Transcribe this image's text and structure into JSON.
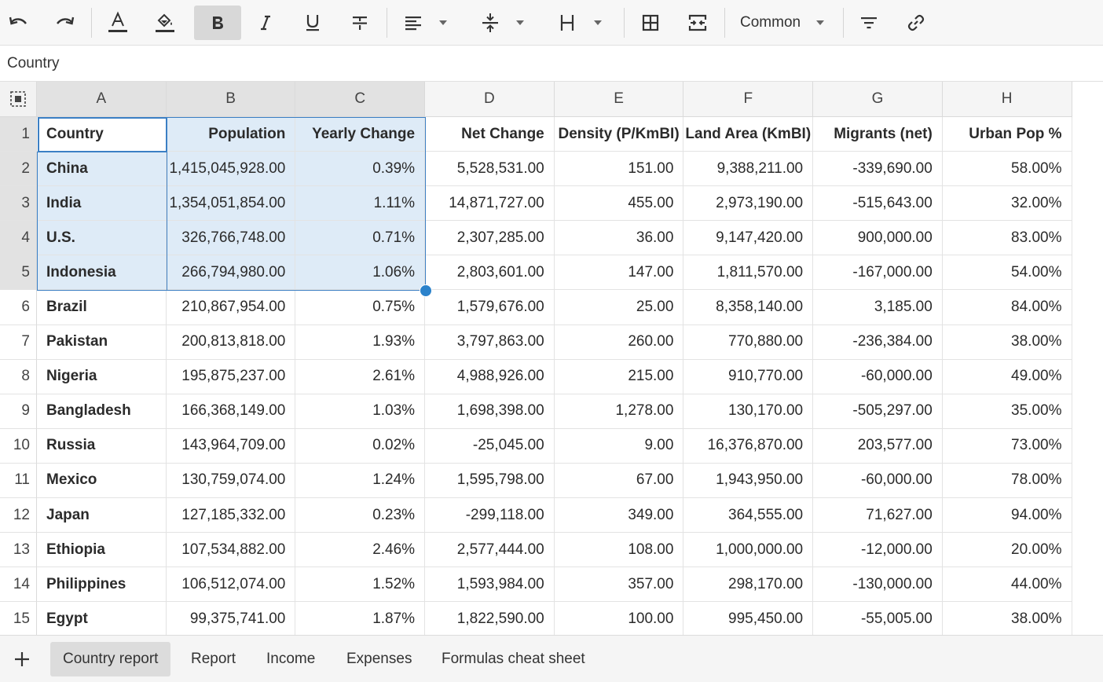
{
  "toolbar": {
    "font_style_label": "Common"
  },
  "formula_bar": {
    "value": "Country"
  },
  "columns": [
    "A",
    "B",
    "C",
    "D",
    "E",
    "F",
    "G",
    "H"
  ],
  "rows": [
    {
      "num": "1",
      "cells": [
        "Country",
        "Population",
        "Yearly Change",
        "Net Change",
        "Density (P/KmBI)",
        "Land Area (KmBI)",
        "Migrants (net)",
        "Urban Pop %"
      ]
    },
    {
      "num": "2",
      "cells": [
        "China",
        "1,415,045,928.00",
        "0.39%",
        "5,528,531.00",
        "151.00",
        "9,388,211.00",
        "-339,690.00",
        "58.00%"
      ]
    },
    {
      "num": "3",
      "cells": [
        "India",
        "1,354,051,854.00",
        "1.11%",
        "14,871,727.00",
        "455.00",
        "2,973,190.00",
        "-515,643.00",
        "32.00%"
      ]
    },
    {
      "num": "4",
      "cells": [
        "U.S.",
        "326,766,748.00",
        "0.71%",
        "2,307,285.00",
        "36.00",
        "9,147,420.00",
        "900,000.00",
        "83.00%"
      ]
    },
    {
      "num": "5",
      "cells": [
        "Indonesia",
        "266,794,980.00",
        "1.06%",
        "2,803,601.00",
        "147.00",
        "1,811,570.00",
        "-167,000.00",
        "54.00%"
      ]
    },
    {
      "num": "6",
      "cells": [
        "Brazil",
        "210,867,954.00",
        "0.75%",
        "1,579,676.00",
        "25.00",
        "8,358,140.00",
        "3,185.00",
        "84.00%"
      ]
    },
    {
      "num": "7",
      "cells": [
        "Pakistan",
        "200,813,818.00",
        "1.93%",
        "3,797,863.00",
        "260.00",
        "770,880.00",
        "-236,384.00",
        "38.00%"
      ]
    },
    {
      "num": "8",
      "cells": [
        "Nigeria",
        "195,875,237.00",
        "2.61%",
        "4,988,926.00",
        "215.00",
        "910,770.00",
        "-60,000.00",
        "49.00%"
      ]
    },
    {
      "num": "9",
      "cells": [
        "Bangladesh",
        "166,368,149.00",
        "1.03%",
        "1,698,398.00",
        "1,278.00",
        "130,170.00",
        "-505,297.00",
        "35.00%"
      ]
    },
    {
      "num": "10",
      "cells": [
        "Russia",
        "143,964,709.00",
        "0.02%",
        "-25,045.00",
        "9.00",
        "16,376,870.00",
        "203,577.00",
        "73.00%"
      ]
    },
    {
      "num": "11",
      "cells": [
        "Mexico",
        "130,759,074.00",
        "1.24%",
        "1,595,798.00",
        "67.00",
        "1,943,950.00",
        "-60,000.00",
        "78.00%"
      ]
    },
    {
      "num": "12",
      "cells": [
        "Japan",
        "127,185,332.00",
        "0.23%",
        "-299,118.00",
        "349.00",
        "364,555.00",
        "71,627.00",
        "94.00%"
      ]
    },
    {
      "num": "13",
      "cells": [
        "Ethiopia",
        "107,534,882.00",
        "2.46%",
        "2,577,444.00",
        "108.00",
        "1,000,000.00",
        "-12,000.00",
        "20.00%"
      ]
    },
    {
      "num": "14",
      "cells": [
        "Philippines",
        "106,512,074.00",
        "1.52%",
        "1,593,984.00",
        "357.00",
        "298,170.00",
        "-130,000.00",
        "44.00%"
      ]
    },
    {
      "num": "15",
      "cells": [
        "Egypt",
        "99,375,741.00",
        "1.87%",
        "1,822,590.00",
        "100.00",
        "995,450.00",
        "-55,005.00",
        "38.00%"
      ]
    }
  ],
  "tabs": [
    "Country report",
    "Report",
    "Income",
    "Expenses",
    "Formulas cheat sheet"
  ],
  "active_tab": "Country report",
  "colors": {
    "selection": "#3b7fc4",
    "selection_fill": "#deebf7"
  }
}
